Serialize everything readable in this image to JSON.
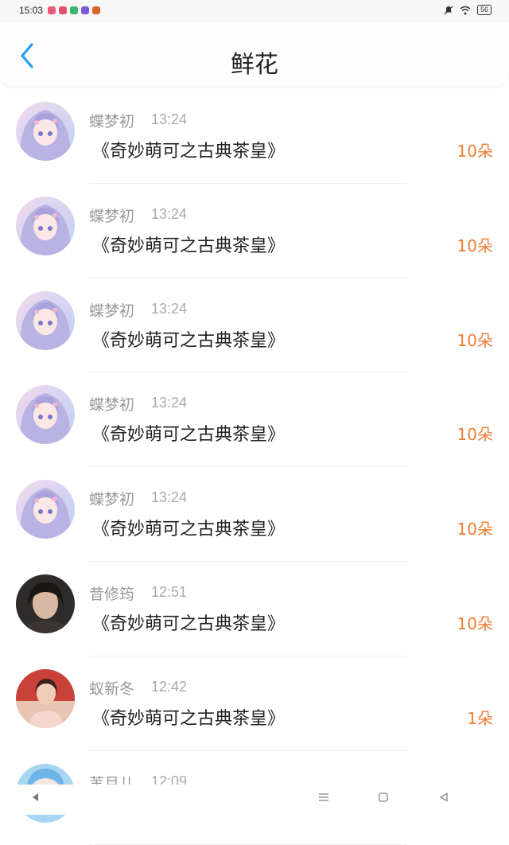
{
  "status_bar": {
    "time": "15:03",
    "battery": "56",
    "app_colors": [
      "#e8587a",
      "#e0506e",
      "#3cb371",
      "#7a5cd6",
      "#e0632a"
    ]
  },
  "header": {
    "title": "鲜花",
    "back_icon": "chevron-left-icon",
    "accent_color": "#2b9cf2"
  },
  "rows": [
    {
      "name": "蝶梦初",
      "time": "13:24",
      "gift": "《奇妙萌可之古典茶皇》",
      "amount": "10朵",
      "avatar": "anime"
    },
    {
      "name": "蝶梦初",
      "time": "13:24",
      "gift": "《奇妙萌可之古典茶皇》",
      "amount": "10朵",
      "avatar": "anime"
    },
    {
      "name": "蝶梦初",
      "time": "13:24",
      "gift": "《奇妙萌可之古典茶皇》",
      "amount": "10朵",
      "avatar": "anime"
    },
    {
      "name": "蝶梦初",
      "time": "13:24",
      "gift": "《奇妙萌可之古典茶皇》",
      "amount": "10朵",
      "avatar": "anime"
    },
    {
      "name": "蝶梦初",
      "time": "13:24",
      "gift": "《奇妙萌可之古典茶皇》",
      "amount": "10朵",
      "avatar": "anime"
    },
    {
      "name": "昔修筠",
      "time": "12:51",
      "gift": "《奇妙萌可之古典茶皇》",
      "amount": "10朵",
      "avatar": "photo-dark"
    },
    {
      "name": "蚁新冬",
      "time": "12:42",
      "gift": "《奇妙萌可之古典茶皇》",
      "amount": "1朵",
      "avatar": "photo-warm"
    },
    {
      "name": "苇月儿",
      "time": "12:09",
      "gift": "",
      "amount": "",
      "avatar": "anime-blue"
    }
  ],
  "nav_bar": {
    "back_icon": "triangle-back-icon",
    "menu_icon": "menu-icon",
    "home_icon": "square-home-icon",
    "recent_icon": "triangle-outline-back-icon"
  }
}
